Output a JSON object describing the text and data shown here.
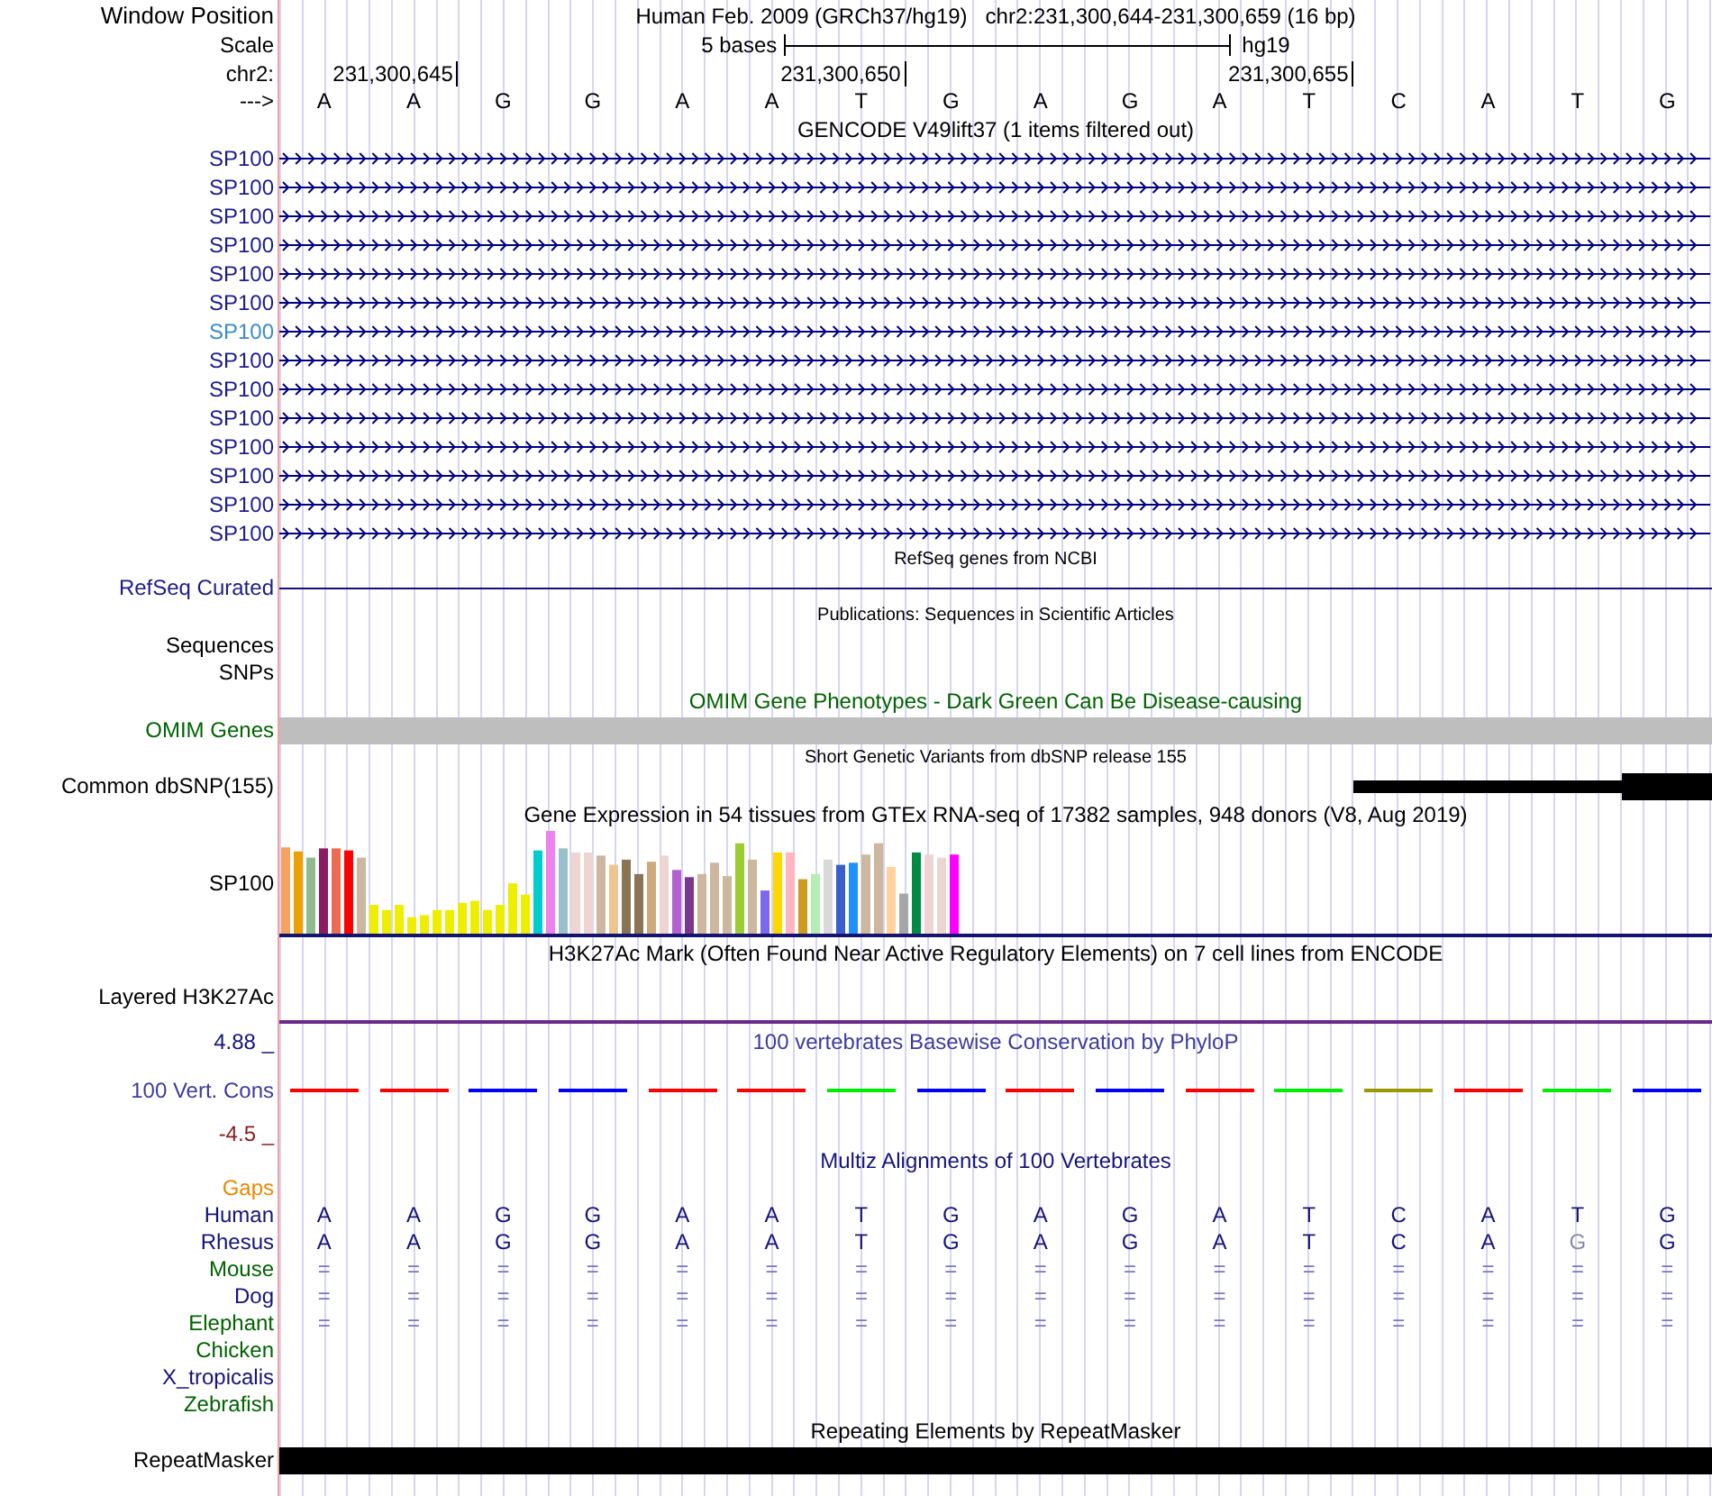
{
  "header": {
    "window_position_label": "Window Position",
    "assembly_title": "Human Feb. 2009 (GRCh37/hg19)",
    "position_title": "chr2:231,300,644-231,300,659 (16 bp)",
    "scale_label": "Scale",
    "scale_text": "5 bases",
    "scale_assembly": "hg19",
    "chrom_label": "chr2:",
    "ruler_positions": [
      "231,300,645",
      "231,300,650",
      "231,300,655"
    ],
    "strand_label": "--->",
    "bases": [
      "A",
      "A",
      "G",
      "G",
      "A",
      "A",
      "T",
      "G",
      "A",
      "G",
      "A",
      "T",
      "C",
      "A",
      "T",
      "G"
    ]
  },
  "tracks": [
    {
      "kind": "gencode",
      "title": "GENCODE V49lift37 (1 items filtered out)",
      "rows": [
        {
          "label": "SP100",
          "highlighted": false
        },
        {
          "label": "SP100",
          "highlighted": false
        },
        {
          "label": "SP100",
          "highlighted": false
        },
        {
          "label": "SP100",
          "highlighted": false
        },
        {
          "label": "SP100",
          "highlighted": false
        },
        {
          "label": "SP100",
          "highlighted": false
        },
        {
          "label": "SP100",
          "highlighted": true
        },
        {
          "label": "SP100",
          "highlighted": false
        },
        {
          "label": "SP100",
          "highlighted": false
        },
        {
          "label": "SP100",
          "highlighted": false
        },
        {
          "label": "SP100",
          "highlighted": false
        },
        {
          "label": "SP100",
          "highlighted": false
        },
        {
          "label": "SP100",
          "highlighted": false
        },
        {
          "label": "SP100",
          "highlighted": false
        }
      ]
    },
    {
      "kind": "refseq",
      "title": "RefSeq genes from NCBI",
      "label": "RefSeq Curated"
    },
    {
      "kind": "publications",
      "title": "Publications: Sequences in Scientific Articles",
      "labels": [
        "Sequences",
        "SNPs"
      ]
    },
    {
      "kind": "omim",
      "title": "OMIM Gene Phenotypes - Dark Green Can Be Disease-causing",
      "label": "OMIM Genes"
    },
    {
      "kind": "dbsnp",
      "title": "Short Genetic Variants from dbSNP release 155",
      "label": "Common dbSNP(155)"
    },
    {
      "kind": "gtex",
      "title": "Gene Expression in 54 tissues from GTEx RNA-seq of 17382 samples, 948 donors (V8, Aug 2019)",
      "label": "SP100"
    },
    {
      "kind": "h3k27ac",
      "title": "H3K27Ac Mark (Often Found Near Active Regulatory Elements) on 7 cell lines from ENCODE",
      "label": "Layered H3K27Ac"
    },
    {
      "kind": "phylop",
      "title": "100 vertebrates Basewise Conservation by PhyloP",
      "label": "100 Vert. Cons",
      "max_label": "4.88 _",
      "min_label": "-4.5 _",
      "segments": [
        {
          "color": "#ff0000"
        },
        {
          "color": "#ff0000"
        },
        {
          "color": "#0000ff"
        },
        {
          "color": "#0000ff"
        },
        {
          "color": "#ff0000"
        },
        {
          "color": "#ff0000"
        },
        {
          "color": "#00ee00"
        },
        {
          "color": "#0000ff"
        },
        {
          "color": "#ff0000"
        },
        {
          "color": "#0000ff"
        },
        {
          "color": "#ff0000"
        },
        {
          "color": "#00ee00"
        },
        {
          "color": "#999900"
        },
        {
          "color": "#ff0000"
        },
        {
          "color": "#00ee00"
        },
        {
          "color": "#0000ff"
        }
      ]
    },
    {
      "kind": "multiz",
      "title": "Multiz Alignments of 100 Vertebrates",
      "gaps_label": "Gaps",
      "species": [
        {
          "name": "Human",
          "color": "#141478",
          "bases": [
            {
              "text": "A",
              "differs": false
            },
            {
              "text": "A",
              "differs": false
            },
            {
              "text": "G",
              "differs": false
            },
            {
              "text": "G",
              "differs": false
            },
            {
              "text": "A",
              "differs": false
            },
            {
              "text": "A",
              "differs": false
            },
            {
              "text": "T",
              "differs": false
            },
            {
              "text": "G",
              "differs": false
            },
            {
              "text": "A",
              "differs": false
            },
            {
              "text": "G",
              "differs": false
            },
            {
              "text": "A",
              "differs": false
            },
            {
              "text": "T",
              "differs": false
            },
            {
              "text": "C",
              "differs": false
            },
            {
              "text": "A",
              "differs": false
            },
            {
              "text": "T",
              "differs": false
            },
            {
              "text": "G",
              "differs": false
            }
          ]
        },
        {
          "name": "Rhesus",
          "color": "#141478",
          "bases": [
            {
              "text": "A",
              "differs": false
            },
            {
              "text": "A",
              "differs": false
            },
            {
              "text": "G",
              "differs": false
            },
            {
              "text": "G",
              "differs": false
            },
            {
              "text": "A",
              "differs": false
            },
            {
              "text": "A",
              "differs": false
            },
            {
              "text": "T",
              "differs": false
            },
            {
              "text": "G",
              "differs": false
            },
            {
              "text": "A",
              "differs": false
            },
            {
              "text": "G",
              "differs": false
            },
            {
              "text": "A",
              "differs": false
            },
            {
              "text": "T",
              "differs": false
            },
            {
              "text": "C",
              "differs": false
            },
            {
              "text": "A",
              "differs": false
            },
            {
              "text": "G",
              "differs": true
            },
            {
              "text": "G",
              "differs": false
            }
          ]
        },
        {
          "name": "Mouse",
          "color": "#006400",
          "bases": [
            {
              "text": "=",
              "differs": false
            },
            {
              "text": "=",
              "differs": false
            },
            {
              "text": "=",
              "differs": false
            },
            {
              "text": "=",
              "differs": false
            },
            {
              "text": "=",
              "differs": false
            },
            {
              "text": "=",
              "differs": false
            },
            {
              "text": "=",
              "differs": false
            },
            {
              "text": "=",
              "differs": false
            },
            {
              "text": "=",
              "differs": false
            },
            {
              "text": "=",
              "differs": false
            },
            {
              "text": "=",
              "differs": false
            },
            {
              "text": "=",
              "differs": false
            },
            {
              "text": "=",
              "differs": false
            },
            {
              "text": "=",
              "differs": false
            },
            {
              "text": "=",
              "differs": false
            },
            {
              "text": "=",
              "differs": false
            }
          ]
        },
        {
          "name": "Dog",
          "color": "#141478",
          "bases": [
            {
              "text": "=",
              "differs": false
            },
            {
              "text": "=",
              "differs": false
            },
            {
              "text": "=",
              "differs": false
            },
            {
              "text": "=",
              "differs": false
            },
            {
              "text": "=",
              "differs": false
            },
            {
              "text": "=",
              "differs": false
            },
            {
              "text": "=",
              "differs": false
            },
            {
              "text": "=",
              "differs": false
            },
            {
              "text": "=",
              "differs": false
            },
            {
              "text": "=",
              "differs": false
            },
            {
              "text": "=",
              "differs": false
            },
            {
              "text": "=",
              "differs": false
            },
            {
              "text": "=",
              "differs": false
            },
            {
              "text": "=",
              "differs": false
            },
            {
              "text": "=",
              "differs": false
            },
            {
              "text": "=",
              "differs": false
            }
          ]
        },
        {
          "name": "Elephant",
          "color": "#006400",
          "bases": [
            {
              "text": "=",
              "differs": false
            },
            {
              "text": "=",
              "differs": false
            },
            {
              "text": "=",
              "differs": false
            },
            {
              "text": "=",
              "differs": false
            },
            {
              "text": "=",
              "differs": false
            },
            {
              "text": "=",
              "differs": false
            },
            {
              "text": "=",
              "differs": false
            },
            {
              "text": "=",
              "differs": false
            },
            {
              "text": "=",
              "differs": false
            },
            {
              "text": "=",
              "differs": false
            },
            {
              "text": "=",
              "differs": false
            },
            {
              "text": "=",
              "differs": false
            },
            {
              "text": "=",
              "differs": false
            },
            {
              "text": "=",
              "differs": false
            },
            {
              "text": "=",
              "differs": false
            },
            {
              "text": "=",
              "differs": false
            }
          ]
        },
        {
          "name": "Chicken",
          "color": "#006400"
        },
        {
          "name": "X_tropicalis",
          "color": "#141478"
        },
        {
          "name": "Zebrafish",
          "color": "#006400"
        }
      ]
    },
    {
      "kind": "repeatmasker",
      "title": "Repeating Elements by RepeatMasker",
      "label": "RepeatMasker"
    }
  ]
}
